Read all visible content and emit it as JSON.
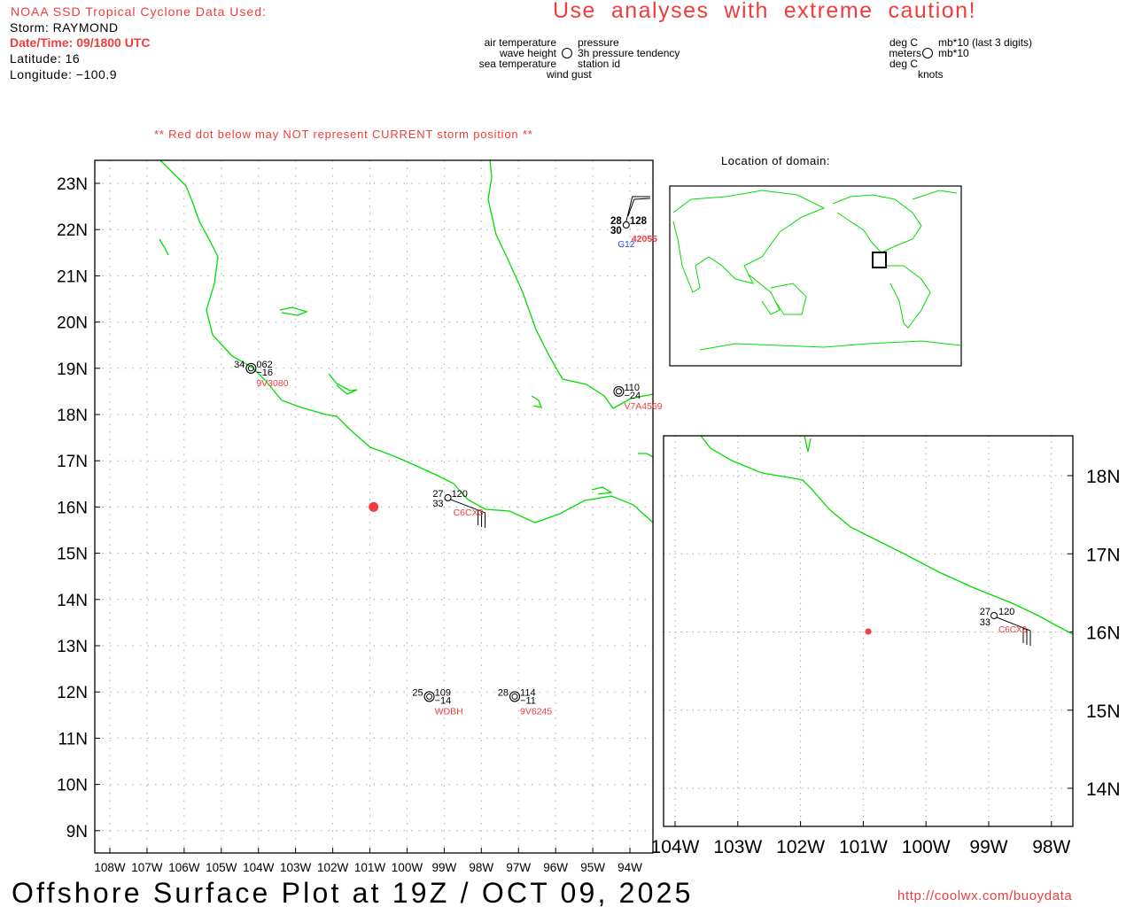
{
  "header": {
    "source_title": "NOAA SSD Tropical Cyclone Data Used:",
    "storm": "Storm: RAYMOND",
    "datetime": "Date/Time: 09/1800 UTC",
    "latitude": "Latitude: 16",
    "longitude": "Longitude: −100.9",
    "caution": "Use  analyses  with  extreme  caution!",
    "red_dot_note": "** Red dot below may NOT represent CURRENT storm position **"
  },
  "legend": {
    "left": {
      "upper_left": "air temperature",
      "middle_left": "wave height",
      "lower_left": "sea temperature",
      "upper_right": "pressure",
      "middle_right": "3h pressure tendency",
      "lower_right": "station id",
      "bottom": "wind gust"
    },
    "right": {
      "upper_left": "deg C",
      "middle_left": "meters",
      "lower_left": "deg C",
      "upper_right": "mb*10 (last 3 digits)",
      "middle_right": "mb*10",
      "bottom": "knots"
    }
  },
  "location_title": "Location of domain:",
  "main_map": {
    "lat_labels": [
      "23N",
      "22N",
      "21N",
      "20N",
      "19N",
      "18N",
      "17N",
      "16N",
      "15N",
      "14N",
      "13N",
      "12N",
      "11N",
      "10N",
      "9N"
    ],
    "lon_labels": [
      "108W",
      "107W",
      "106W",
      "105W",
      "104W",
      "103W",
      "102W",
      "101W",
      "100W",
      "99W",
      "98W",
      "97W",
      "96W",
      "95W",
      "94W"
    ]
  },
  "inset_map": {
    "lat_labels": [
      "18N",
      "17N",
      "16N",
      "15N",
      "14N"
    ],
    "lon_labels": [
      "104W",
      "103W",
      "102W",
      "101W",
      "100W",
      "99W",
      "98W"
    ]
  },
  "storm": {
    "lat": 16,
    "lon": -100.9,
    "color": "#f03c3c"
  },
  "stations": [
    {
      "id": "42055",
      "air": "28",
      "pressure": "128",
      "sea": "30",
      "tendency": "",
      "extra": "G12",
      "lat": 22.1,
      "lon": -94.1,
      "double": false,
      "bold": true,
      "barb": true
    },
    {
      "id": "9V3080",
      "air": "34",
      "pressure": "062",
      "sea": "",
      "tendency": "−16",
      "extra": "",
      "lat": 19.0,
      "lon": -104.2,
      "double": true,
      "bold": false,
      "barb": false
    },
    {
      "id": "V7A4569",
      "air": "",
      "pressure": "110",
      "sea": "",
      "tendency": "−24",
      "extra": "",
      "lat": 18.5,
      "lon": -94.3,
      "double": true,
      "bold": false,
      "barb": false
    },
    {
      "id": "C6CX3",
      "air": "27",
      "pressure": "120",
      "sea": "33",
      "tendency": "",
      "extra": "",
      "lat": 16.2,
      "lon": -98.9,
      "double": false,
      "bold": false,
      "barb": true
    },
    {
      "id": "WDBH",
      "air": "25",
      "pressure": "109",
      "sea": "",
      "tendency": "−14",
      "extra": "",
      "lat": 11.9,
      "lon": -99.4,
      "double": true,
      "bold": false,
      "barb": false
    },
    {
      "id": "9V6245",
      "air": "28",
      "pressure": "114",
      "sea": "",
      "tendency": "−11",
      "extra": "",
      "lat": 11.9,
      "lon": -97.1,
      "double": true,
      "bold": false,
      "barb": false
    }
  ],
  "inset_station": {
    "id": "C6CX3",
    "air": "27",
    "pressure": "120",
    "sea": "33"
  },
  "footer": {
    "title": "Offshore Surface Plot at 19Z / OCT 09, 2025",
    "url": "http://coolwx.com/buoydata"
  },
  "colors": {
    "coast": "#00dd00",
    "red": "#f03c3c",
    "grid": "#aaaaaa",
    "blue": "#1e3cff"
  }
}
